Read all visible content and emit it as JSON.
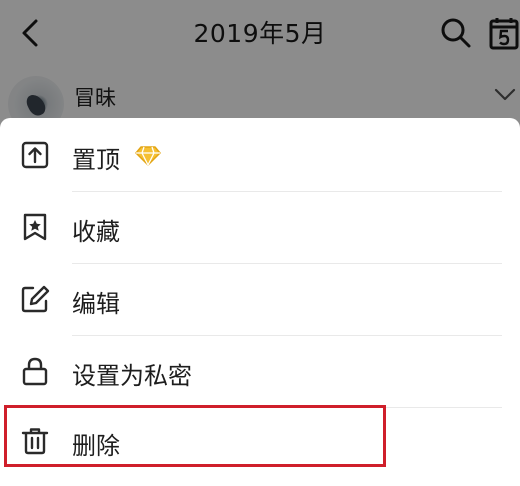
{
  "header": {
    "title": "2019年5月"
  },
  "post": {
    "author": "冒昧"
  },
  "menu": {
    "items": [
      {
        "label": "置顶",
        "icon": "pin-top-icon",
        "badge_icon": "diamond-icon"
      },
      {
        "label": "收藏",
        "icon": "bookmark-star-icon"
      },
      {
        "label": "编辑",
        "icon": "edit-icon"
      },
      {
        "label": "设置为私密",
        "icon": "lock-icon"
      },
      {
        "label": "删除",
        "icon": "trash-icon"
      }
    ],
    "highlighted_item": "删除"
  },
  "colors": {
    "highlight_border": "#cf1f2a",
    "diamond": "#f5c034",
    "icon_stroke": "#2a2a2a",
    "overlay": "rgba(0,0,0,0.45)"
  }
}
